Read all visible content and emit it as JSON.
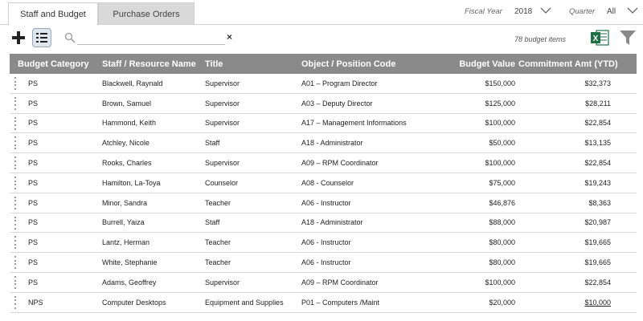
{
  "tabs": [
    {
      "label": "Staff and Budget",
      "active": true
    },
    {
      "label": "Purchase Orders",
      "active": false
    }
  ],
  "filters": {
    "fiscal_year_label": "Fiscal Year",
    "fiscal_year_value": "2018",
    "quarter_label": "Quarter",
    "quarter_value": "All"
  },
  "toolbar": {
    "add_icon": "plus-icon",
    "list_icon": "list-icon",
    "search_placeholder": "",
    "search_value": "",
    "clear_label": "×",
    "count_text": "78 budget items",
    "export_icon": "excel-icon",
    "filter_icon": "funnel-icon"
  },
  "table": {
    "columns": [
      "Budget Category",
      "Staff / Resource Name",
      "Title",
      "Object / Position Code",
      "Budget Value",
      "Commitment Amt (YTD)"
    ],
    "rows": [
      [
        "PS",
        "Blackwell, Raynald",
        "Supervisor",
        "A01 – Program Director",
        "$150,000",
        "$32,373"
      ],
      [
        "PS",
        "Brown, Samuel",
        "Supervisor",
        "A03 – Deputy Director",
        "$125,000",
        "$28,211"
      ],
      [
        "PS",
        "Hammond, Keith",
        "Supervisor",
        "A17 – Management Informations",
        "$100,000",
        "$22,854"
      ],
      [
        "PS",
        "Atchley, Nicole",
        "Staff",
        "A18 - Administrator",
        "$50,000",
        "$13,135"
      ],
      [
        "PS",
        "Rooks, Charles",
        "Supervisor",
        "A09 – RPM Coordinator",
        "$100,000",
        "$22,854"
      ],
      [
        "PS",
        "Hamilton, La-Toya",
        "Counselor",
        "A08 - Counselor",
        "$75,000",
        "$19,243"
      ],
      [
        "PS",
        "Minor, Sandra",
        "Teacher",
        "A06 - Instructor",
        "$46,876",
        "$8,363"
      ],
      [
        "PS",
        "Burrell, Yaiza",
        "Staff",
        "A18 - Administrator",
        "$88,000",
        "$20,987"
      ],
      [
        "PS",
        "Lantz, Herman",
        "Teacher",
        "A06 - Instructor",
        "$80,000",
        "$19,665"
      ],
      [
        "PS",
        "White, Stephanie",
        "Teacher",
        "A06 - Instructor",
        "$80,000",
        "$19,665"
      ],
      [
        "PS",
        "Adams, Geoffrey",
        "Supervisor",
        "A09 – RPM Coordinator",
        "$100,000",
        "$22,854"
      ],
      [
        "NPS",
        "Computer Desktops",
        "Equipment and Supplies",
        "P01 – Computers /Maint",
        "$20,000",
        "$10,000"
      ]
    ]
  },
  "colors": {
    "header_bg": "#8a8a8a",
    "excel_green": "#1e7145",
    "tab_inactive": "#d9d9d9"
  }
}
